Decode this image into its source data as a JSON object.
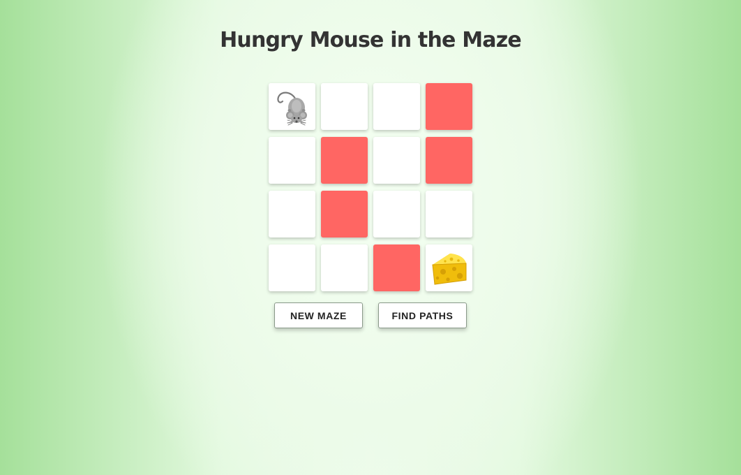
{
  "title": "Hungry Mouse in the Maze",
  "colors": {
    "wall": "#ff6663",
    "open": "#ffffff",
    "title": "#333333",
    "background_center": "#effced",
    "background_edge": "#a5e09a"
  },
  "maze": {
    "rows": 4,
    "cols": 4,
    "cells": [
      [
        "mouse",
        "open",
        "open",
        "wall"
      ],
      [
        "open",
        "wall",
        "open",
        "wall"
      ],
      [
        "open",
        "wall",
        "open",
        "open"
      ],
      [
        "open",
        "open",
        "wall",
        "cheese"
      ]
    ],
    "icons": {
      "mouse": "mouse-icon",
      "cheese": "cheese-icon"
    }
  },
  "buttons": {
    "new_maze": "NEW MAZE",
    "find_paths": "FIND PATHS"
  }
}
